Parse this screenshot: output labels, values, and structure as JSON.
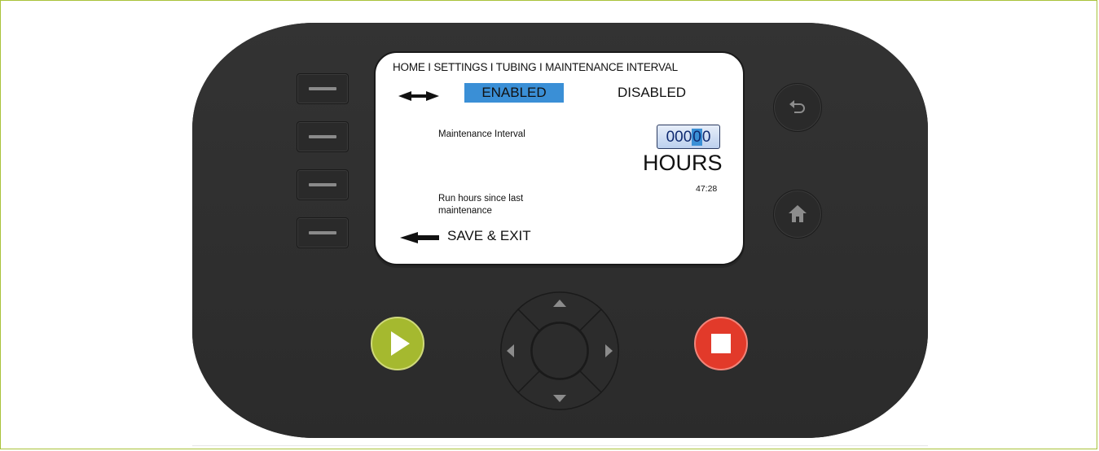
{
  "screen": {
    "breadcrumb": "HOME I SETTINGS I TUBING I MAINTENANCE INTERVAL",
    "option_enabled": "ENABLED",
    "option_disabled": "DISABLED",
    "maintenance_label": "Maintenance Interval",
    "hours_value_prefix": "000",
    "hours_value_selected": "0",
    "hours_value_suffix": "0",
    "hours_unit": "HOURS",
    "run_hours_value": "47:28",
    "run_hours_label": "Run hours since last maintenance",
    "save_exit": "SAVE & EXIT"
  },
  "device": {
    "soft_keys": 4,
    "buttons": [
      "back-icon",
      "home-icon",
      "play-icon",
      "stop-icon"
    ],
    "dpad": [
      "up-icon",
      "down-icon",
      "left-icon",
      "right-icon"
    ]
  },
  "colors": {
    "frame": "#a9c23a",
    "device_body": "#2f2f2f",
    "highlight": "#3a8fd6",
    "play": "#a5b92f",
    "stop": "#e23a2a"
  }
}
